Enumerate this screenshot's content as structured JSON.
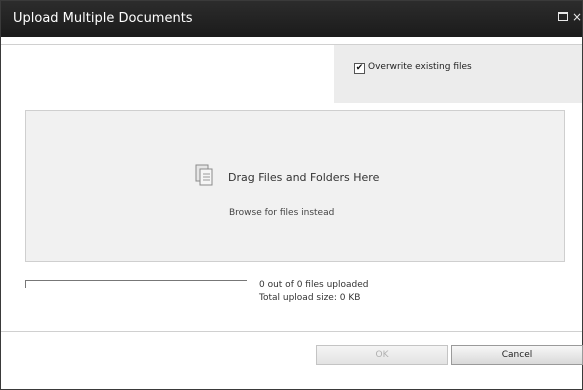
{
  "dialog": {
    "title": "Upload Multiple Documents",
    "maximize_icon": "maximize-icon",
    "close_glyph": "×"
  },
  "options": {
    "overwrite_checked": true,
    "overwrite_check_glyph": "✔",
    "overwrite_label": "Overwrite existing files"
  },
  "drop_zone": {
    "icon": "documents-icon",
    "drag_text": "Drag Files and Folders Here",
    "browse_link": "Browse for files instead"
  },
  "status": {
    "progress": 0,
    "files_uploaded": "0 out of 0 files uploaded",
    "total_size": "Total upload size: 0 KB"
  },
  "buttons": {
    "ok_label": "OK",
    "ok_disabled": true,
    "cancel_label": "Cancel"
  },
  "colors": {
    "titlebar": "#222222",
    "drop_zone_bg": "#f1f1f1",
    "options_bg": "#ececec"
  }
}
